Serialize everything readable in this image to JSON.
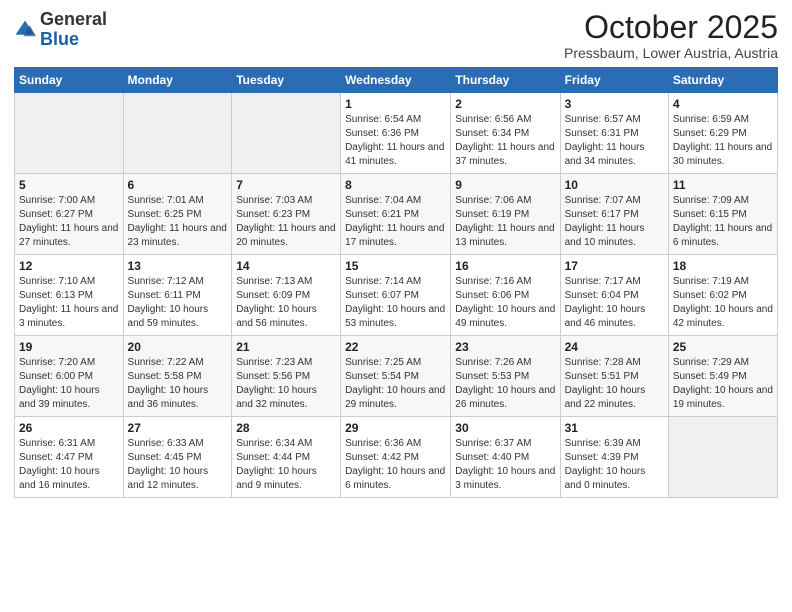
{
  "header": {
    "logo_general": "General",
    "logo_blue": "Blue",
    "month": "October 2025",
    "location": "Pressbaum, Lower Austria, Austria"
  },
  "columns": [
    "Sunday",
    "Monday",
    "Tuesday",
    "Wednesday",
    "Thursday",
    "Friday",
    "Saturday"
  ],
  "weeks": [
    [
      {
        "day": "",
        "info": ""
      },
      {
        "day": "",
        "info": ""
      },
      {
        "day": "",
        "info": ""
      },
      {
        "day": "1",
        "info": "Sunrise: 6:54 AM\nSunset: 6:36 PM\nDaylight: 11 hours\nand 41 minutes."
      },
      {
        "day": "2",
        "info": "Sunrise: 6:56 AM\nSunset: 6:34 PM\nDaylight: 11 hours\nand 37 minutes."
      },
      {
        "day": "3",
        "info": "Sunrise: 6:57 AM\nSunset: 6:31 PM\nDaylight: 11 hours\nand 34 minutes."
      },
      {
        "day": "4",
        "info": "Sunrise: 6:59 AM\nSunset: 6:29 PM\nDaylight: 11 hours\nand 30 minutes."
      }
    ],
    [
      {
        "day": "5",
        "info": "Sunrise: 7:00 AM\nSunset: 6:27 PM\nDaylight: 11 hours\nand 27 minutes."
      },
      {
        "day": "6",
        "info": "Sunrise: 7:01 AM\nSunset: 6:25 PM\nDaylight: 11 hours\nand 23 minutes."
      },
      {
        "day": "7",
        "info": "Sunrise: 7:03 AM\nSunset: 6:23 PM\nDaylight: 11 hours\nand 20 minutes."
      },
      {
        "day": "8",
        "info": "Sunrise: 7:04 AM\nSunset: 6:21 PM\nDaylight: 11 hours\nand 17 minutes."
      },
      {
        "day": "9",
        "info": "Sunrise: 7:06 AM\nSunset: 6:19 PM\nDaylight: 11 hours\nand 13 minutes."
      },
      {
        "day": "10",
        "info": "Sunrise: 7:07 AM\nSunset: 6:17 PM\nDaylight: 11 hours\nand 10 minutes."
      },
      {
        "day": "11",
        "info": "Sunrise: 7:09 AM\nSunset: 6:15 PM\nDaylight: 11 hours\nand 6 minutes."
      }
    ],
    [
      {
        "day": "12",
        "info": "Sunrise: 7:10 AM\nSunset: 6:13 PM\nDaylight: 11 hours\nand 3 minutes."
      },
      {
        "day": "13",
        "info": "Sunrise: 7:12 AM\nSunset: 6:11 PM\nDaylight: 10 hours\nand 59 minutes."
      },
      {
        "day": "14",
        "info": "Sunrise: 7:13 AM\nSunset: 6:09 PM\nDaylight: 10 hours\nand 56 minutes."
      },
      {
        "day": "15",
        "info": "Sunrise: 7:14 AM\nSunset: 6:07 PM\nDaylight: 10 hours\nand 53 minutes."
      },
      {
        "day": "16",
        "info": "Sunrise: 7:16 AM\nSunset: 6:06 PM\nDaylight: 10 hours\nand 49 minutes."
      },
      {
        "day": "17",
        "info": "Sunrise: 7:17 AM\nSunset: 6:04 PM\nDaylight: 10 hours\nand 46 minutes."
      },
      {
        "day": "18",
        "info": "Sunrise: 7:19 AM\nSunset: 6:02 PM\nDaylight: 10 hours\nand 42 minutes."
      }
    ],
    [
      {
        "day": "19",
        "info": "Sunrise: 7:20 AM\nSunset: 6:00 PM\nDaylight: 10 hours\nand 39 minutes."
      },
      {
        "day": "20",
        "info": "Sunrise: 7:22 AM\nSunset: 5:58 PM\nDaylight: 10 hours\nand 36 minutes."
      },
      {
        "day": "21",
        "info": "Sunrise: 7:23 AM\nSunset: 5:56 PM\nDaylight: 10 hours\nand 32 minutes."
      },
      {
        "day": "22",
        "info": "Sunrise: 7:25 AM\nSunset: 5:54 PM\nDaylight: 10 hours\nand 29 minutes."
      },
      {
        "day": "23",
        "info": "Sunrise: 7:26 AM\nSunset: 5:53 PM\nDaylight: 10 hours\nand 26 minutes."
      },
      {
        "day": "24",
        "info": "Sunrise: 7:28 AM\nSunset: 5:51 PM\nDaylight: 10 hours\nand 22 minutes."
      },
      {
        "day": "25",
        "info": "Sunrise: 7:29 AM\nSunset: 5:49 PM\nDaylight: 10 hours\nand 19 minutes."
      }
    ],
    [
      {
        "day": "26",
        "info": "Sunrise: 6:31 AM\nSunset: 4:47 PM\nDaylight: 10 hours\nand 16 minutes."
      },
      {
        "day": "27",
        "info": "Sunrise: 6:33 AM\nSunset: 4:45 PM\nDaylight: 10 hours\nand 12 minutes."
      },
      {
        "day": "28",
        "info": "Sunrise: 6:34 AM\nSunset: 4:44 PM\nDaylight: 10 hours\nand 9 minutes."
      },
      {
        "day": "29",
        "info": "Sunrise: 6:36 AM\nSunset: 4:42 PM\nDaylight: 10 hours\nand 6 minutes."
      },
      {
        "day": "30",
        "info": "Sunrise: 6:37 AM\nSunset: 4:40 PM\nDaylight: 10 hours\nand 3 minutes."
      },
      {
        "day": "31",
        "info": "Sunrise: 6:39 AM\nSunset: 4:39 PM\nDaylight: 10 hours\nand 0 minutes."
      },
      {
        "day": "",
        "info": ""
      }
    ]
  ]
}
